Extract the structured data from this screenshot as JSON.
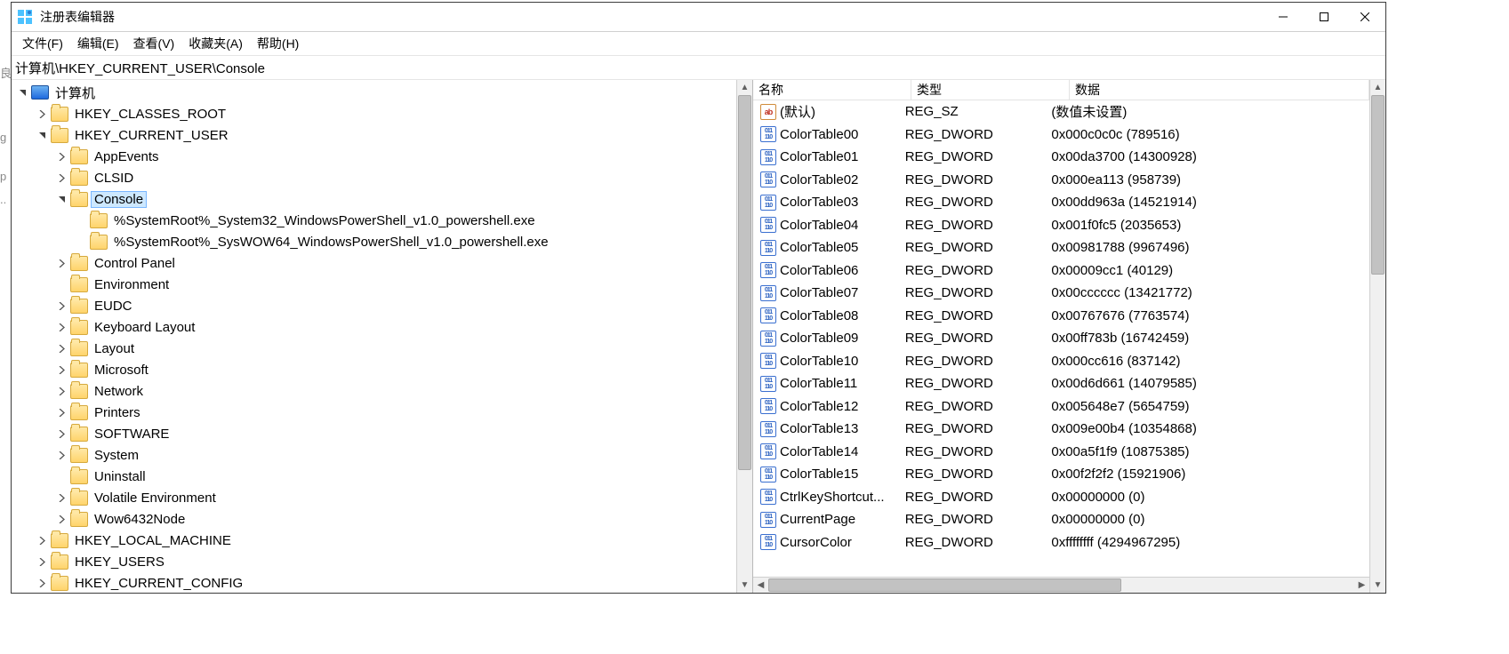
{
  "window_title": "注册表编辑器",
  "menu": {
    "file": "文件(F)",
    "edit": "编辑(E)",
    "view": "查看(V)",
    "favorites": "收藏夹(A)",
    "help": "帮助(H)"
  },
  "address": "计算机\\HKEY_CURRENT_USER\\Console",
  "tree": {
    "root": "计算机",
    "hcr": "HKEY_CLASSES_ROOT",
    "hcu": "HKEY_CURRENT_USER",
    "hcu_children": [
      {
        "k": "AppEvents",
        "exp": 0,
        "has": 1
      },
      {
        "k": "CLSID",
        "exp": 0,
        "has": 1
      },
      {
        "k": "Console",
        "exp": 1,
        "has": 1,
        "sel": 1,
        "children": [
          "%SystemRoot%_System32_WindowsPowerShell_v1.0_powershell.exe",
          "%SystemRoot%_SysWOW64_WindowsPowerShell_v1.0_powershell.exe"
        ]
      },
      {
        "k": "Control Panel",
        "exp": 0,
        "has": 1
      },
      {
        "k": "Environment",
        "exp": 0,
        "has": 0
      },
      {
        "k": "EUDC",
        "exp": 0,
        "has": 1
      },
      {
        "k": "Keyboard Layout",
        "exp": 0,
        "has": 1
      },
      {
        "k": "Layout",
        "exp": 0,
        "has": 1
      },
      {
        "k": "Microsoft",
        "exp": 0,
        "has": 1
      },
      {
        "k": "Network",
        "exp": 0,
        "has": 1
      },
      {
        "k": "Printers",
        "exp": 0,
        "has": 1
      },
      {
        "k": "SOFTWARE",
        "exp": 0,
        "has": 1
      },
      {
        "k": "System",
        "exp": 0,
        "has": 1
      },
      {
        "k": "Uninstall",
        "exp": 0,
        "has": 0
      },
      {
        "k": "Volatile Environment",
        "exp": 0,
        "has": 1
      },
      {
        "k": "Wow6432Node",
        "exp": 0,
        "has": 1
      }
    ],
    "hlm": "HKEY_LOCAL_MACHINE",
    "hu": "HKEY_USERS",
    "hcc": "HKEY_CURRENT_CONFIG"
  },
  "list": {
    "cols": {
      "name": "名称",
      "type": "类型",
      "data": "数据"
    },
    "widths": {
      "name": 165,
      "type": 165,
      "data": 380
    },
    "rows": [
      {
        "icon": "sz",
        "name": "(默认)",
        "type": "REG_SZ",
        "data": "(数值未设置)"
      },
      {
        "icon": "dw",
        "name": "ColorTable00",
        "type": "REG_DWORD",
        "data": "0x000c0c0c (789516)"
      },
      {
        "icon": "dw",
        "name": "ColorTable01",
        "type": "REG_DWORD",
        "data": "0x00da3700 (14300928)"
      },
      {
        "icon": "dw",
        "name": "ColorTable02",
        "type": "REG_DWORD",
        "data": "0x000ea113 (958739)"
      },
      {
        "icon": "dw",
        "name": "ColorTable03",
        "type": "REG_DWORD",
        "data": "0x00dd963a (14521914)"
      },
      {
        "icon": "dw",
        "name": "ColorTable04",
        "type": "REG_DWORD",
        "data": "0x001f0fc5 (2035653)"
      },
      {
        "icon": "dw",
        "name": "ColorTable05",
        "type": "REG_DWORD",
        "data": "0x00981788 (9967496)"
      },
      {
        "icon": "dw",
        "name": "ColorTable06",
        "type": "REG_DWORD",
        "data": "0x00009cc1 (40129)"
      },
      {
        "icon": "dw",
        "name": "ColorTable07",
        "type": "REG_DWORD",
        "data": "0x00cccccc (13421772)"
      },
      {
        "icon": "dw",
        "name": "ColorTable08",
        "type": "REG_DWORD",
        "data": "0x00767676 (7763574)"
      },
      {
        "icon": "dw",
        "name": "ColorTable09",
        "type": "REG_DWORD",
        "data": "0x00ff783b (16742459)"
      },
      {
        "icon": "dw",
        "name": "ColorTable10",
        "type": "REG_DWORD",
        "data": "0x000cc616 (837142)"
      },
      {
        "icon": "dw",
        "name": "ColorTable11",
        "type": "REG_DWORD",
        "data": "0x00d6d661 (14079585)"
      },
      {
        "icon": "dw",
        "name": "ColorTable12",
        "type": "REG_DWORD",
        "data": "0x005648e7 (5654759)"
      },
      {
        "icon": "dw",
        "name": "ColorTable13",
        "type": "REG_DWORD",
        "data": "0x009e00b4 (10354868)"
      },
      {
        "icon": "dw",
        "name": "ColorTable14",
        "type": "REG_DWORD",
        "data": "0x00a5f1f9 (10875385)"
      },
      {
        "icon": "dw",
        "name": "ColorTable15",
        "type": "REG_DWORD",
        "data": "0x00f2f2f2 (15921906)"
      },
      {
        "icon": "dw",
        "name": "CtrlKeyShortcut...",
        "type": "REG_DWORD",
        "data": "0x00000000 (0)"
      },
      {
        "icon": "dw",
        "name": "CurrentPage",
        "type": "REG_DWORD",
        "data": "0x00000000 (0)"
      },
      {
        "icon": "dw",
        "name": "CursorColor",
        "type": "REG_DWORD",
        "data": "0xffffffff (4294967295)"
      }
    ]
  },
  "edge_chars": [
    "g",
    "p",
    ".."
  ]
}
